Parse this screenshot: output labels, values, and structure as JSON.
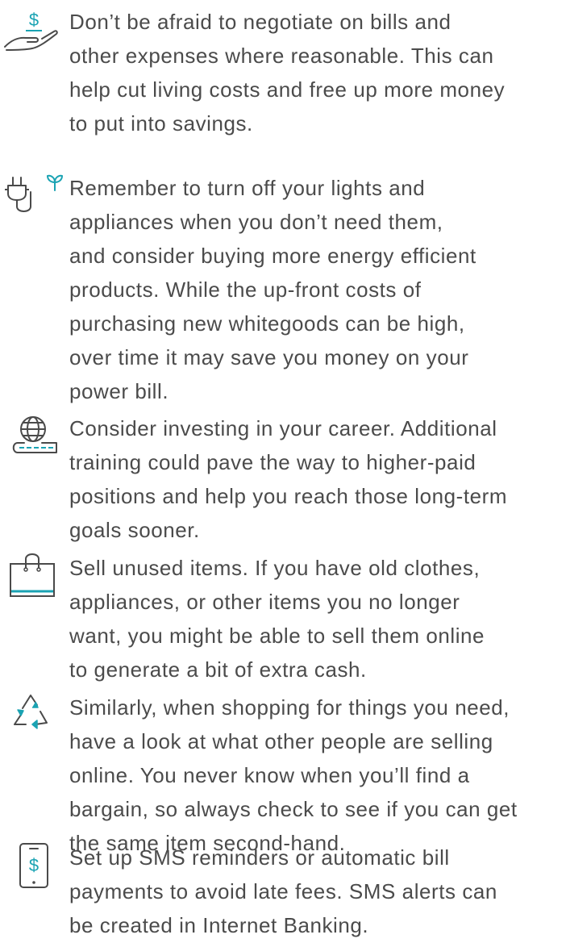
{
  "tips": [
    {
      "icon": "hand-dollar-icon",
      "lines": [
        "Don’t be afraid to negotiate on bills and",
        "other expenses where reasonable. This can",
        "help cut living costs and free up more money",
        "to put into savings."
      ]
    },
    {
      "icon": "plug-sprout-icon",
      "lines": [
        "Remember to turn off your lights and",
        "appliances when you don’t need them,",
        "and consider buying more energy efficient",
        "products. While the up-front costs of",
        "purchasing new whitegoods can be high,",
        "over time it may save you money on your",
        "power bill."
      ]
    },
    {
      "icon": "globe-book-icon",
      "lines": [
        "Consider investing in your career. Additional",
        "training could pave the way to higher-paid",
        "positions and help you reach those long-term",
        "goals sooner."
      ]
    },
    {
      "icon": "shopping-bag-icon",
      "lines": [
        "Sell unused items. If you have old clothes,",
        "appliances, or other items you no longer",
        "want, you might be able to sell them online",
        "to generate a bit of extra cash."
      ]
    },
    {
      "icon": "recycle-icon",
      "lines": [
        "Similarly, when shopping for things you need,",
        "have a look at what other people are selling",
        "online. You never know when you’ll find a",
        "bargain, so always check to see if you can get",
        "the same item second-hand."
      ]
    },
    {
      "icon": "phone-dollar-icon",
      "lines": [
        "Set up SMS reminders or automatic bill",
        "payments to avoid late fees. SMS alerts can",
        "be created in Internet Banking."
      ]
    }
  ],
  "colors": {
    "text": "#4b4b4b",
    "icon_stroke": "#4a4a4a",
    "accent": "#1aa3b3"
  }
}
